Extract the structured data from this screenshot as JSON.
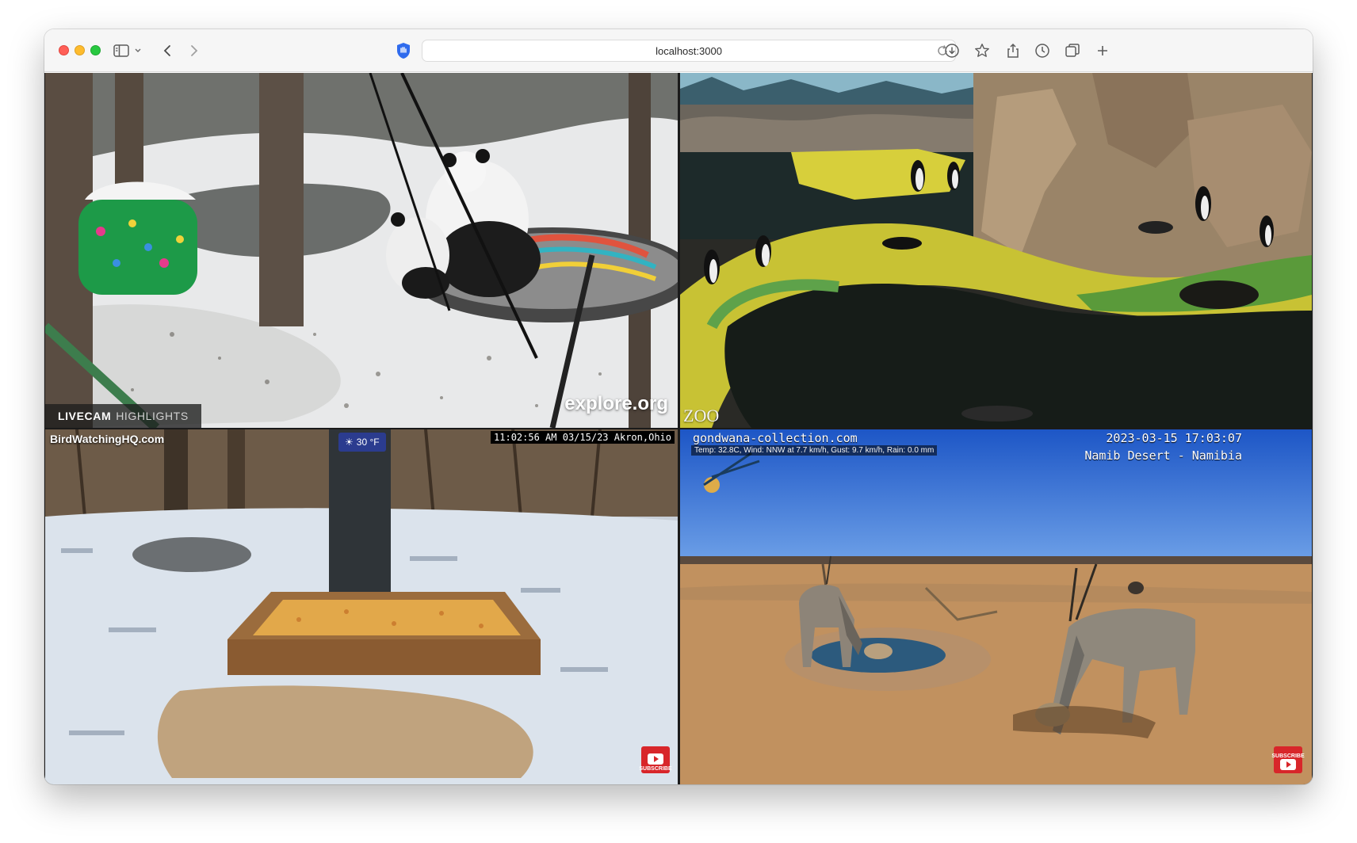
{
  "browser": {
    "url": "localhost:3000"
  },
  "cams": {
    "panda": {
      "badge_bold": "LIVECAM",
      "badge_light": "HIGHLIGHTS",
      "watermark": "explore.org"
    },
    "penguin": {
      "logo_text": "ZOO"
    },
    "birds": {
      "site": "BirdWatchingHQ.com",
      "temperature": "30 °F",
      "timestamp": "11:02:56 AM 03/15/23 Akron,Ohio",
      "subscribe": "SUBSCRIBE"
    },
    "desert": {
      "site": "gondwana-collection.com",
      "datetime": "2023-03-15 17:03:07",
      "location": "Namib Desert - Namibia",
      "weather": "Temp: 32.8C, Wind: NNW at 7.7 km/h, Gust: 9.7 km/h, Rain: 0.0 mm",
      "subscribe": "SUBSCRIBE"
    }
  }
}
